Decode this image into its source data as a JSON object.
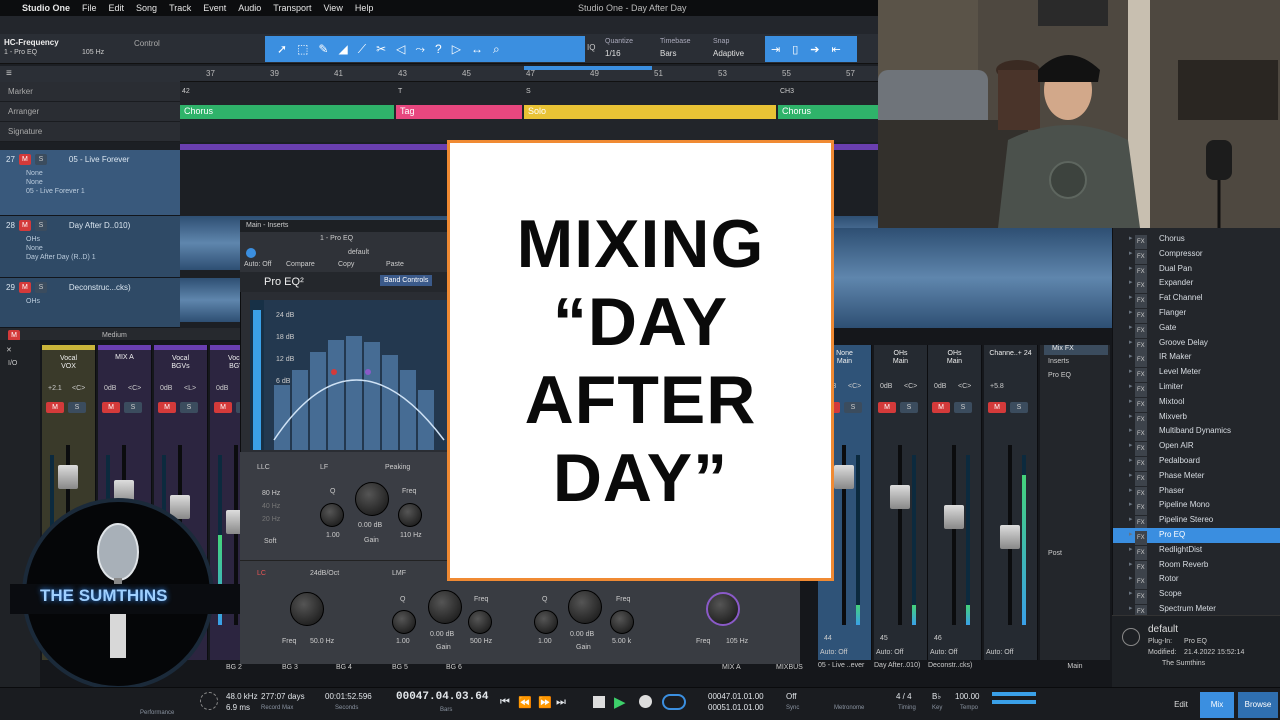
{
  "menubar": {
    "app": "Studio One",
    "items": [
      "File",
      "Edit",
      "Song",
      "Track",
      "Event",
      "Audio",
      "Transport",
      "View",
      "Help"
    ],
    "window_title": "Studio One - Day After Day"
  },
  "toolbar": {
    "track": "HC-Frequency",
    "insert": "1 - Pro EQ",
    "freq": "105 Hz",
    "control": "Control",
    "quantize_label": "Quantize",
    "quantize": "1/16",
    "timebase_label": "Timebase",
    "timebase": "Bars",
    "snap_label": "Snap",
    "snap": "Adaptive",
    "iq": "IQ"
  },
  "ruler": [
    "37",
    "39",
    "41",
    "43",
    "45",
    "47",
    "49",
    "51",
    "53",
    "55",
    "57"
  ],
  "lanes": {
    "marker": "Marker",
    "arranger": "Arranger",
    "signature": "Signature"
  },
  "arranger": [
    {
      "label": "Chorus",
      "color": "#2fb36a"
    },
    {
      "label": "Tag",
      "color": "#e8477f"
    },
    {
      "label": "Solo",
      "color": "#e9c335"
    },
    {
      "label": "Chorus",
      "color": "#2fb36a"
    }
  ],
  "markers": [
    "42",
    "T",
    "S",
    "CH3"
  ],
  "tracks": [
    {
      "num": "27",
      "name": "05 - Live Forever",
      "sub": [
        "None",
        "None",
        "05 - Live Forever 1"
      ]
    },
    {
      "num": "28",
      "name": "Day After D..010)",
      "sub": [
        "OHs",
        "None",
        "Day After Day (R..D) 1"
      ]
    },
    {
      "num": "29",
      "name": "Deconstruc...cks)",
      "sub": [
        "OHs",
        ""
      ]
    }
  ],
  "plugin": {
    "window": "Main - Inserts",
    "slot": "1 - Pro EQ",
    "preset": "default",
    "compare": "Compare",
    "copy": "Copy",
    "paste": "Paste",
    "auto": "Auto: Off",
    "name": "Pro EQ²",
    "band_controls": "Band Controls",
    "db": [
      "24 dB",
      "18 dB",
      "12 dB",
      "6 dB"
    ],
    "llc": "LLC",
    "llc_vals": [
      "80 Hz",
      "40 Hz",
      "20 Hz"
    ],
    "soft": "Soft",
    "lf": {
      "label": "LF",
      "shape": "Peaking",
      "q_label": "Q",
      "q": "1.00",
      "gain": "0.00 dB",
      "gain_label": "Gain",
      "freq_label": "Freq",
      "freq": "110 Hz"
    },
    "lc": {
      "label": "LC",
      "slope": "24dB/Oct",
      "freq_label": "Freq",
      "freq": "50.0 Hz"
    },
    "lmf": {
      "label": "LMF",
      "q_label": "Q",
      "q": "1.00",
      "gain": "0.00 dB",
      "gain_label": "Gain",
      "freq_label": "Freq",
      "freq": "500 Hz"
    },
    "mf": {
      "q_label": "Q",
      "q": "1.00",
      "gain": "0.00 dB",
      "gain_label": "Gain",
      "freq_label": "Freq",
      "freq": "5.00 k"
    },
    "hf": {
      "freq_label": "Freq",
      "freq": "105 Hz"
    }
  },
  "mixer": {
    "scope": "Medium",
    "strips": [
      {
        "name": "Vocal",
        "sub": "VOX",
        "color": "#c9b43a",
        "gain": "+2.1",
        "pan": "<C>"
      },
      {
        "name": "",
        "sub": "MIX A",
        "color": "#6a3fb0",
        "gain": "0dB",
        "pan": "<C>"
      },
      {
        "name": "Vocal",
        "sub": "BGVs",
        "color": "#6a3fb0",
        "gain": "0dB",
        "pan": "<L>"
      },
      {
        "name": "Vocal",
        "sub": "BGV",
        "color": "#6a3fb0",
        "gain": "0dB",
        "pan": ""
      }
    ],
    "right_strips": [
      {
        "name": "None",
        "sub": "Main",
        "gain": "0dB",
        "pan": "<C>",
        "num": "44",
        "label": "05 - Live ..ever",
        "auto": "Auto: Off"
      },
      {
        "name": "OHs",
        "sub": "Main",
        "gain": "0dB",
        "pan": "<C>",
        "num": "45",
        "label": "Day After..010)",
        "auto": "Auto: Off"
      },
      {
        "name": "OHs",
        "sub": "Main",
        "gain": "0dB",
        "pan": "<C>",
        "num": "46",
        "label": "Deconstr..cks)",
        "auto": "Auto: Off"
      },
      {
        "name": "Channe..+ 24",
        "sub": "",
        "gain": "+5.8",
        "pan": "",
        "num": "",
        "label": "",
        "auto": "Auto: Off"
      }
    ],
    "main": {
      "fx": "Mix FX",
      "inserts": "Inserts",
      "insert1": "Pro EQ",
      "post": "Post",
      "label": "Main"
    },
    "bottom": [
      "BG 2",
      "BG 3",
      "BG 4",
      "BG 5",
      "BG 6",
      "MIX A",
      "MIXBUS"
    ]
  },
  "card": [
    "MIXING",
    "“DAY",
    "AFTER",
    "DAY”"
  ],
  "browser": {
    "items": [
      "Chorus",
      "Compressor",
      "Dual Pan",
      "Expander",
      "Fat Channel",
      "Flanger",
      "Gate",
      "Groove Delay",
      "IR Maker",
      "Level Meter",
      "Limiter",
      "Mixtool",
      "Mixverb",
      "Multiband Dynamics",
      "Open AIR",
      "Pedalboard",
      "Phase Meter",
      "Phaser",
      "Pipeline Mono",
      "Pipeline Stereo",
      "Pro EQ",
      "RedlightDist",
      "Room Reverb",
      "Rotor",
      "Scope",
      "Spectrum Meter"
    ],
    "selected": "Pro EQ",
    "preset": {
      "name": "default",
      "plugin_label": "Plug-In:",
      "plugin": "Pro EQ",
      "modified_label": "Modified:",
      "modified": "21.4.2022 15:52:14",
      "author": "The Sumthins"
    }
  },
  "transport": {
    "rate": "48.0 kHz",
    "latency": "6.9 ms",
    "perf": "Performance",
    "record_max": "277:07 days",
    "record_label": "Record Max",
    "seconds": "00:01:52.596",
    "seconds_label": "Seconds",
    "bars": "00047.04.03.64",
    "bars_label": "Bars",
    "l": "00047.01.01.00",
    "r": "00051.01.01.00",
    "sync": "Off",
    "sync_label": "Sync",
    "metronome": "Metronome",
    "timing": "4 / 4",
    "timing_label": "Timing",
    "key": "B♭",
    "key_label": "Key",
    "tempo": "100.00",
    "tempo_label": "Tempo",
    "edit": "Edit",
    "mix": "Mix",
    "browse": "Browse"
  },
  "logo": "THE SUMTHINS"
}
